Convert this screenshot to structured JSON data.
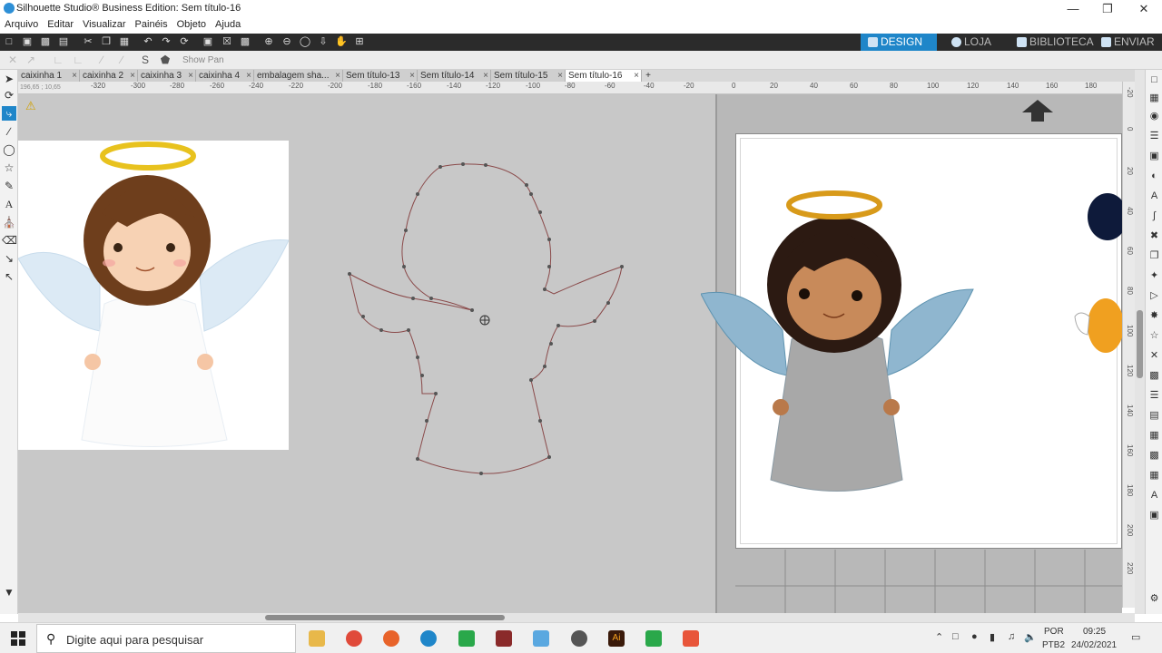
{
  "window": {
    "title": "Silhouette Studio® Business Edition: Sem título-16"
  },
  "menu": [
    "Arquivo",
    "Editar",
    "Visualizar",
    "Painéis",
    "Objeto",
    "Ajuda"
  ],
  "top_tabs": {
    "design": "DESIGN",
    "loja": "LOJA",
    "biblioteca": "BIBLIOTECA",
    "enviar": "ENVIAR",
    "active": "DESIGN",
    "accent": "#1f86c9"
  },
  "toolbar2": {
    "show_pan": "Show Pan"
  },
  "doc_tabs": {
    "items": [
      "caixinha 1",
      "caixinha 2",
      "caixinha 3",
      "caixinha 4",
      "embalagem sha...",
      "Sem título-13",
      "Sem título-14",
      "Sem título-15",
      "Sem título-16"
    ],
    "active": "Sem título-16",
    "add": "+"
  },
  "ruler": {
    "coords": "196,65 ; 10,65",
    "h_labels": [
      "-320",
      "-300",
      "-280",
      "-260",
      "-240",
      "-220",
      "-200",
      "-180",
      "-160",
      "-140",
      "-120",
      "-100",
      "-80",
      "-60",
      "-40",
      "-20",
      "0",
      "20",
      "40",
      "60",
      "80",
      "100",
      "120",
      "140",
      "160",
      "180"
    ],
    "v_labels": [
      "-20",
      "0",
      "20",
      "40",
      "60",
      "80",
      "100",
      "120",
      "140",
      "160",
      "180",
      "200",
      "220"
    ]
  },
  "taskbar": {
    "search_placeholder": "Digite aqui para pesquisar",
    "lang_top": "POR",
    "lang_bottom": "PTB2",
    "time": "09:25",
    "date": "24/02/2021"
  }
}
